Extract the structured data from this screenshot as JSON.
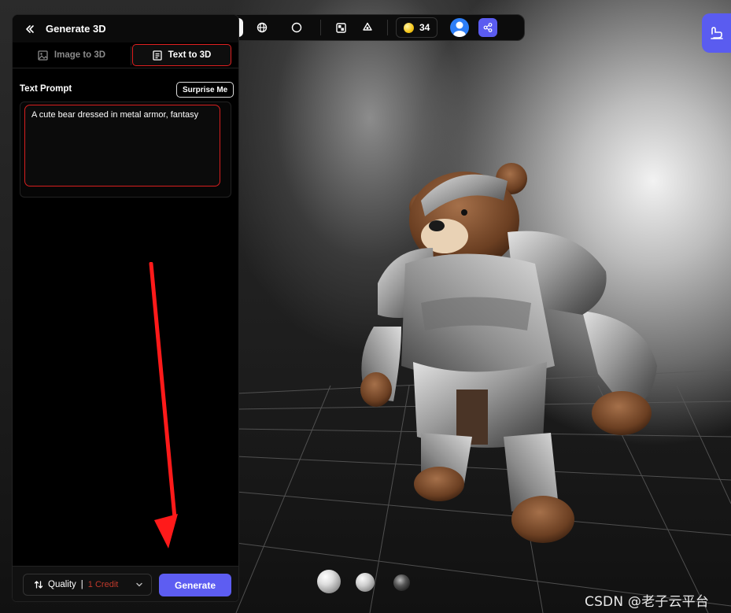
{
  "panel": {
    "title": "Generate 3D",
    "tabs": [
      {
        "label": "Image to 3D",
        "icon": "image-icon",
        "active": false
      },
      {
        "label": "Text to 3D",
        "icon": "document-icon",
        "active": true
      }
    ],
    "prompt_label": "Text Prompt",
    "surprise_label": "Surprise Me",
    "prompt_value": "A cute bear dressed in metal armor, fantasy",
    "quality_label": "Quality",
    "quality_separator": "|",
    "quality_credit": "1 Credit",
    "generate_label": "Generate"
  },
  "toolbar": {
    "view_modes": [
      "textured-view-icon",
      "wireframe-globe-icon",
      "clay-sphere-icon"
    ],
    "active_view": 0,
    "tools": [
      "texture-grid-icon",
      "recycle-icon"
    ],
    "credits": "34"
  },
  "materials": [
    "matte-ball",
    "glossy-ball",
    "metal-ball"
  ],
  "watermark": "CSDN @老子云平台",
  "colors": {
    "accent": "#5d5df2",
    "highlight_red": "#e02020",
    "panel_bg": "#000000"
  }
}
